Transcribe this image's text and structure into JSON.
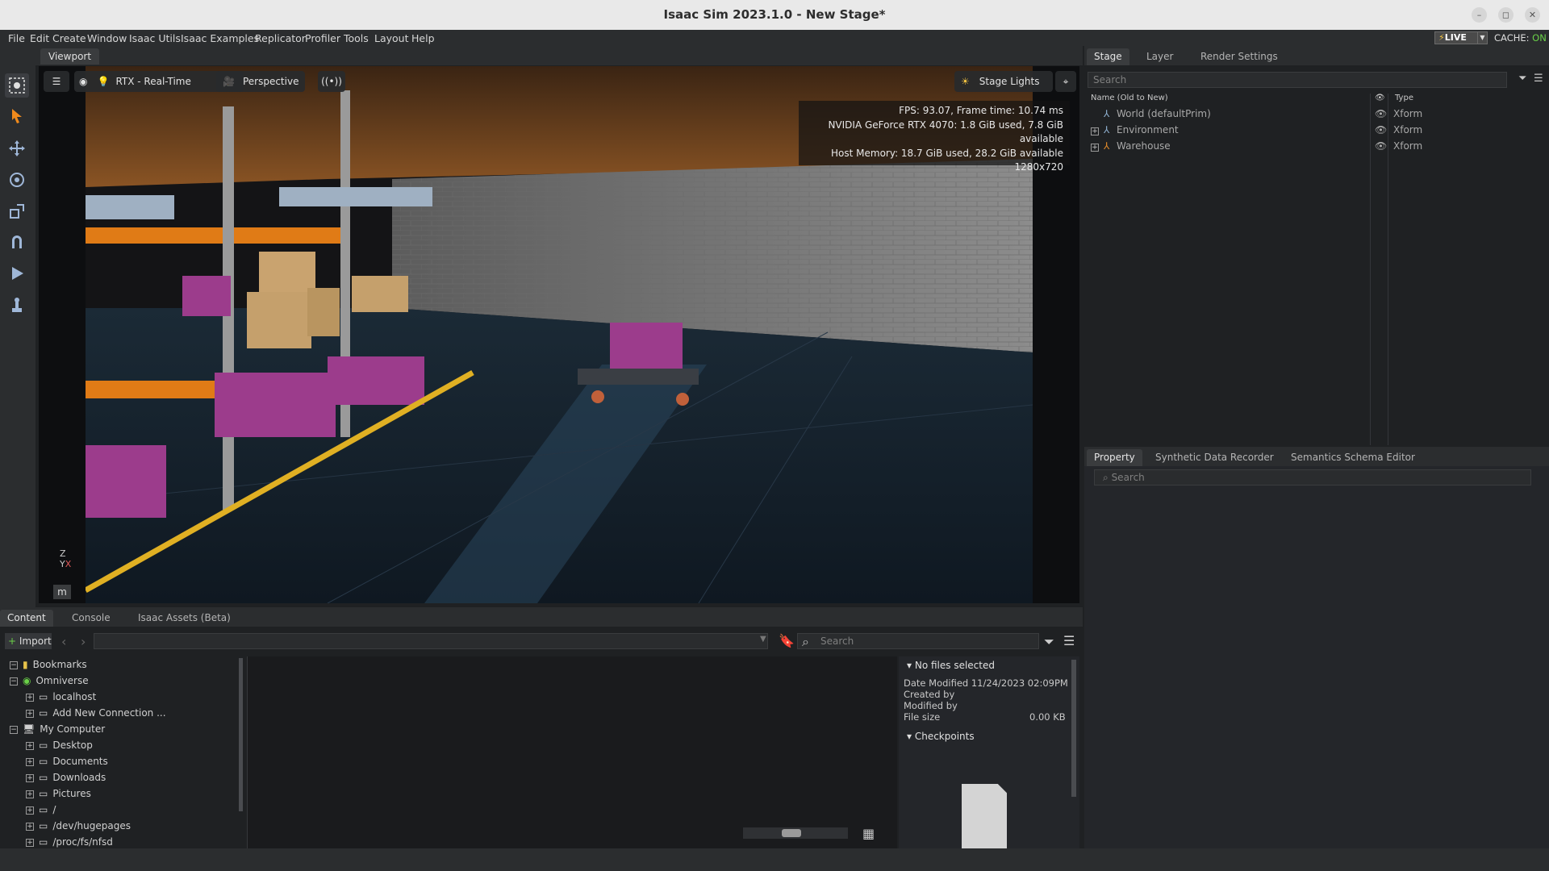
{
  "window": {
    "title": "Isaac Sim 2023.1.0 - New Stage*",
    "controls": [
      "–",
      "◻",
      "✕"
    ]
  },
  "menu": {
    "items": [
      "File",
      "Edit",
      "Create",
      "Window",
      "Isaac Utils",
      "Isaac Examples",
      "Replicator",
      "Profiler",
      "Tools",
      "Layout",
      "Help"
    ],
    "live_label": "LIVE",
    "cache_label": "CACHE:",
    "cache_state": "ON"
  },
  "viewport": {
    "tab_label": "Viewport",
    "renderer_label": "RTX - Real-Time",
    "camera_label": "Perspective",
    "lights_label": "Stage Lights",
    "stats": {
      "fps": "FPS: 93.07, Frame time: 10.74 ms",
      "gpu": "NVIDIA GeForce RTX 4070: 1.8 GiB used, 7.8 GiB available",
      "host": "Host Memory: 18.7 GiB used, 28.2 GiB available",
      "resolution": "1280x720"
    },
    "units_label": "m",
    "axis_z": "Z",
    "axis_y": "Y",
    "axis_x": "X"
  },
  "stage": {
    "tabs": [
      "Stage",
      "Layer",
      "Render Settings"
    ],
    "search_placeholder": "Search",
    "column_name": "Name (Old to New)",
    "column_type": "Type",
    "rows": [
      {
        "name": "World (defaultPrim)",
        "type": "Xform"
      },
      {
        "name": "Environment",
        "type": "Xform"
      },
      {
        "name": "Warehouse",
        "type": "Xform"
      }
    ]
  },
  "property": {
    "tabs": [
      "Property",
      "Synthetic Data Recorder",
      "Semantics Schema Editor"
    ],
    "search_placeholder": "Search"
  },
  "content": {
    "tabs": [
      "Content",
      "Console",
      "Isaac Assets (Beta)"
    ],
    "import_label": "Import",
    "search_placeholder": "Search",
    "tree": [
      {
        "label": "Bookmarks",
        "level": 0,
        "toggle": "−"
      },
      {
        "label": "Omniverse",
        "level": 0,
        "toggle": "−"
      },
      {
        "label": "localhost",
        "level": 1,
        "toggle": "+"
      },
      {
        "label": "Add New Connection ...",
        "level": 1,
        "toggle": "+"
      },
      {
        "label": "My Computer",
        "level": 0,
        "toggle": "−"
      },
      {
        "label": "Desktop",
        "level": 1,
        "toggle": "+"
      },
      {
        "label": "Documents",
        "level": 1,
        "toggle": "+"
      },
      {
        "label": "Downloads",
        "level": 1,
        "toggle": "+"
      },
      {
        "label": "Pictures",
        "level": 1,
        "toggle": "+"
      },
      {
        "label": "/",
        "level": 1,
        "toggle": "+"
      },
      {
        "label": "/dev/hugepages",
        "level": 1,
        "toggle": "+"
      },
      {
        "label": "/proc/fs/nfsd",
        "level": 1,
        "toggle": "+"
      }
    ],
    "info": {
      "header": "No files selected",
      "date_modified": "Date Modified 11/24/2023 02:09PM",
      "created_by": "Created by",
      "modified_by": "Modified by",
      "file_size_label": "File size",
      "file_size_value": "0.00 KB",
      "checkpoints": "Checkpoints"
    }
  }
}
